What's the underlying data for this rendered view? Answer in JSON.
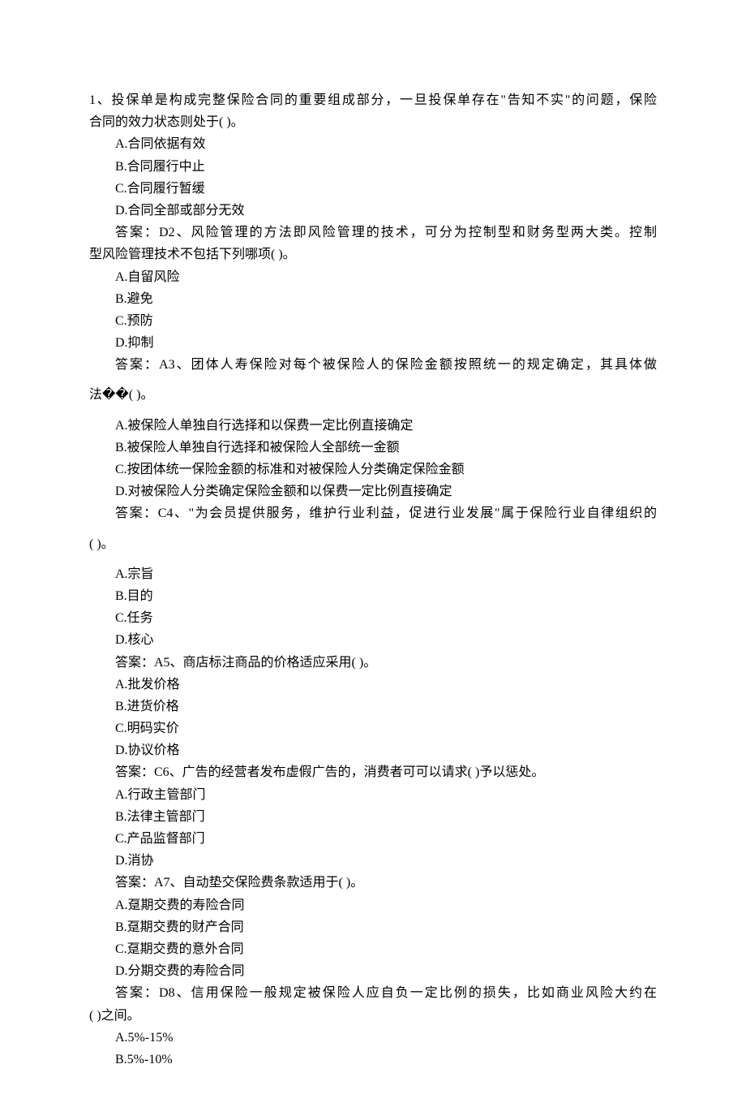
{
  "q1": {
    "text_l1": "1、投保单是构成完整保险合同的重要组成部分，一旦投保单存在\"告知不实\"的问题，保险",
    "text_l2": "合同的效力状态则处于( )。",
    "a": "A.合同依据有效",
    "b": "B.合同履行中止",
    "c": "C.合同履行暂缓",
    "d": "D.合同全部或部分无效"
  },
  "a1q2": {
    "line": "答案：D2、风险管理的方法即风险管理的技术，可分为控制型和财务型两大类。控制",
    "cont": "型风险管理技术不包括下列哪项( )。",
    "a": "A.自留风险",
    "b": "B.避免",
    "c": "C.预防",
    "d": "D.抑制"
  },
  "a2q3": {
    "line": "答案：A3、团体人寿保险对每个被保险人的保险金额按照统一的规定确定，其具体做",
    "cont": "法��( )。",
    "a": "A.被保险人单独自行选择和以保费一定比例直接确定",
    "b": "B.被保险人单独自行选择和被保险人全部统一金额",
    "c": "C.按团体统一保险金额的标准和对被保险人分类确定保险金额",
    "d": "D.对被保险人分类确定保险金额和以保费一定比例直接确定"
  },
  "a3q4": {
    "line": "答案：C4、\"为会员提供服务，维护行业利益，促进行业发展\"属于保险行业自律组织的",
    "cont": "( )。",
    "a": "A.宗旨",
    "b": "B.目的",
    "c": "C.任务",
    "d": "D.核心"
  },
  "a4q5": {
    "line": "答案：A5、商店标注商品的价格适应采用( )。",
    "a": "A.批发价格",
    "b": "B.进货价格",
    "c": "C.明码实价",
    "d": "D.协议价格"
  },
  "a5q6": {
    "line": "答案：C6、广告的经营者发布虚假广告的，消费者可可以请求( )予以惩处。",
    "a": "A.行政主管部门",
    "b": "B.法律主管部门",
    "c": "C.产品监督部门",
    "d": "D.消协"
  },
  "a6q7": {
    "line": "答案：A7、自动垫交保险费条款适用于( )。",
    "a": "A.趸期交费的寿险合同",
    "b": "B.趸期交费的财产合同",
    "c": "C.趸期交费的意外合同",
    "d": "D.分期交费的寿险合同"
  },
  "a7q8": {
    "line": "答案：D8、信用保险一般规定被保险人应自负一定比例的损失，比如商业风险大约在",
    "cont": "( )之间。",
    "a": "A.5%-15%",
    "b": "B.5%-10%"
  }
}
